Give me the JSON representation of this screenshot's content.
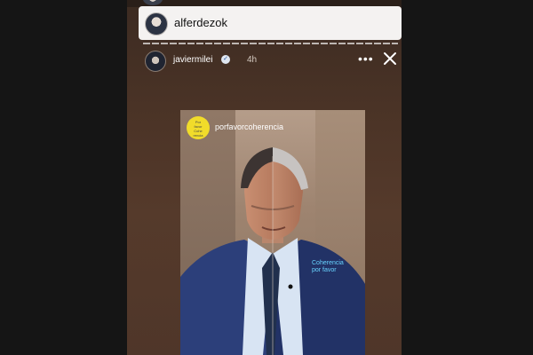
{
  "app": {
    "colors": {
      "viewer_bg": "#4a3326",
      "caption_accent": "#68d3ff",
      "sticker_bg": "#f1dc2a",
      "progress": "#ffffff"
    }
  },
  "account_card": {
    "username": "alferdezok",
    "avatar_icon": "user-avatar-icon"
  },
  "story_header": {
    "username": "javiermilei",
    "verified_icon": "verified-badge-icon",
    "time": "4h",
    "more_icon": "more-options-icon",
    "close_icon": "close-icon"
  },
  "story": {
    "handle": "porfavorcoherencia",
    "sticker_text": "Por\nfavor\nCohe\nrencia",
    "caption": "Coherencia\npor favor"
  }
}
